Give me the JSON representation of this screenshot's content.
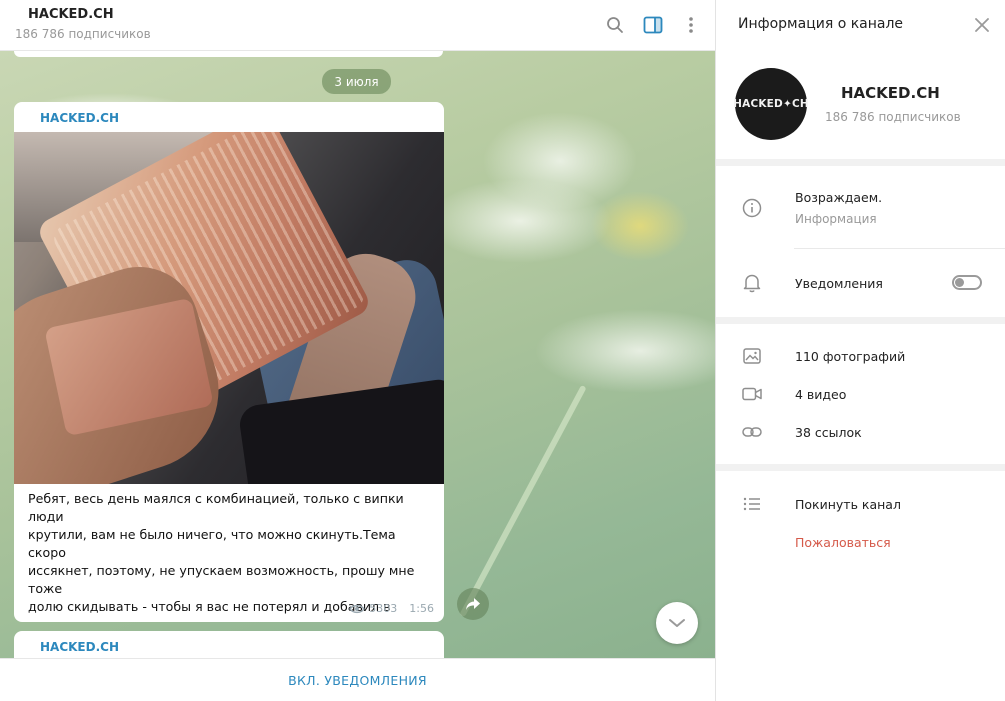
{
  "chat_header": {
    "title": "HACKED.CH",
    "subtitle": "186 786 подписчиков"
  },
  "icons": {
    "search": "search-icon",
    "side_panel": "side-panel-icon",
    "more": "more-vertical-icon",
    "close": "close-icon",
    "info": "info-icon",
    "bell": "bell-icon",
    "photo": "photo-icon",
    "video": "video-icon",
    "link": "link-icon",
    "list": "list-icon",
    "eye": "eye-icon",
    "share": "share-icon",
    "chevron": "chevron-down-icon"
  },
  "chat": {
    "date_label": "3 июля",
    "message": {
      "author": "HACKED.CH",
      "text": "Ребят, весь день маялся с комбинацией, только с випки люди\nкрутили, вам не было ничего, что можно скинуть.Тема скоро\nиссякнет, поэтому, не упускаем возможность, прошу мне тоже\nдолю скидывать - чтобы я вас не потерял и добавил в випку,\nработаем в том же режиме, но даже побольше!Сегодня\nпостараюсь с випки вам тоже скинуть комбинацию!Готовимся!\nЯ на вас надеюсь!",
      "views": "5303",
      "time": "1:56"
    },
    "next_message": {
      "author": "HACKED.CH"
    }
  },
  "footer": {
    "notify_label": "ВКЛ. УВЕДОМЛЕНИЯ"
  },
  "info_panel": {
    "title": "Информация о канале",
    "avatar_text": "HACKED✦CH",
    "channel_name": "HACKED.CH",
    "subscribers": "186 786 подписчиков",
    "description": "Возраждаем.",
    "description_caption": "Информация",
    "notifications_label": "Уведомления",
    "notifications_enabled": false,
    "photos": "110 фотографий",
    "videos": "4 видео",
    "links": "38 ссылок",
    "leave": "Покинуть канал",
    "report": "Пожаловаться"
  },
  "colors": {
    "accent": "#2c88bd",
    "danger": "#d55a4a",
    "muted": "#999999",
    "date_pill": "#7a9668"
  }
}
